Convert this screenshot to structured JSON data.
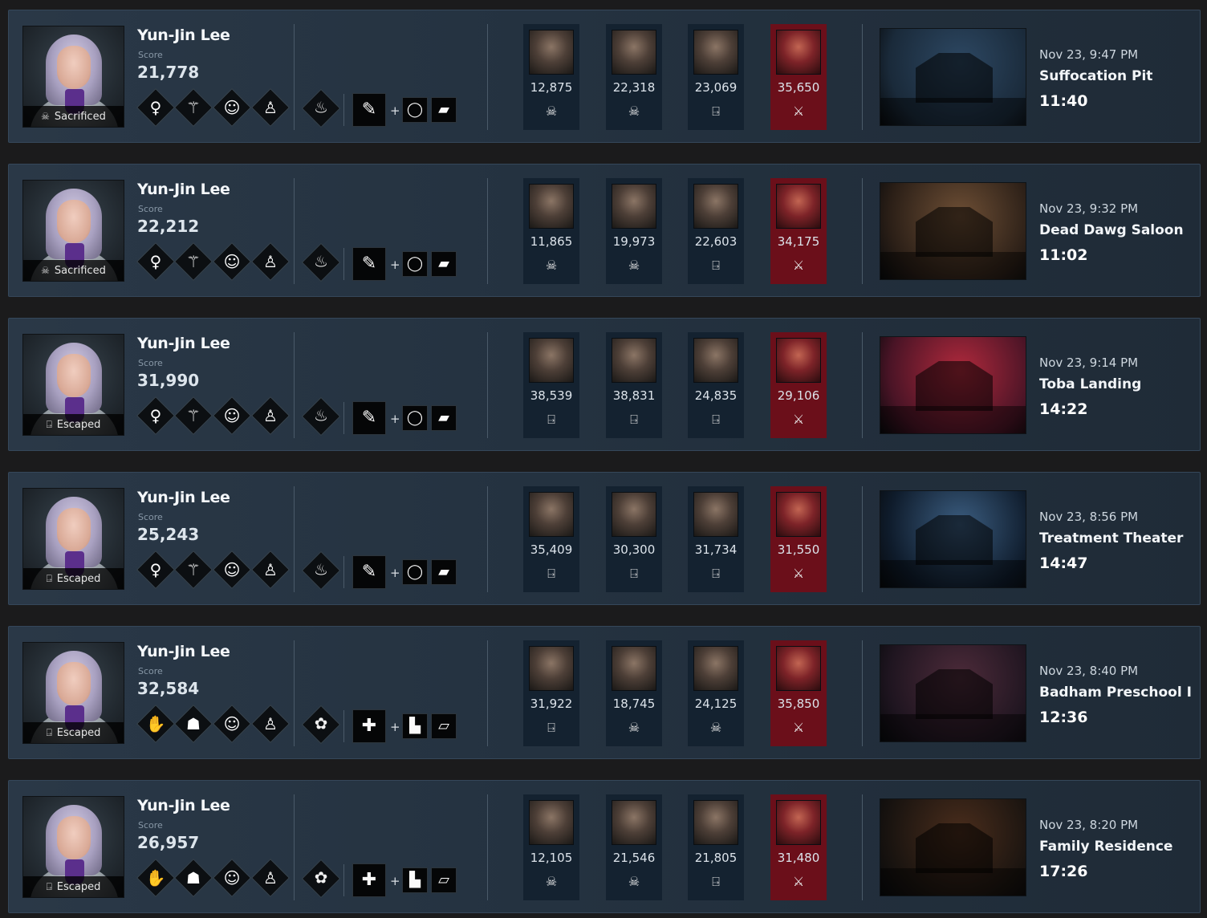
{
  "matches": [
    {
      "player": {
        "name": "Yun-Jin Lee",
        "score_label": "Score",
        "score": "21,778",
        "status": "Sacrificed",
        "status_icon": "skull"
      },
      "perks": [
        "adrenaline-icon",
        "lithe-icon",
        "fixated-icon",
        "dance-icon"
      ],
      "offering": "cake-icon",
      "item": "flashlight-icon",
      "addons": [
        "ring-icon",
        "battery-icon"
      ],
      "others": [
        {
          "score": "12,875",
          "result_icon": "skull",
          "role": "survivor"
        },
        {
          "score": "22,318",
          "result_icon": "skull",
          "role": "survivor"
        },
        {
          "score": "23,069",
          "result_icon": "escape",
          "role": "survivor"
        },
        {
          "score": "35,650",
          "result_icon": "killer",
          "role": "killer"
        }
      ],
      "map": {
        "date": "Nov 23, 9:47 PM",
        "name": "Suffocation Pit",
        "duration": "11:40",
        "tint": [
          "#1a2a3a",
          "#2d4863"
        ]
      }
    },
    {
      "player": {
        "name": "Yun-Jin Lee",
        "score_label": "Score",
        "score": "22,212",
        "status": "Sacrificed",
        "status_icon": "skull"
      },
      "perks": [
        "adrenaline-icon",
        "lithe-icon",
        "fixated-icon",
        "dance-icon"
      ],
      "offering": "cake-icon",
      "item": "flashlight-icon",
      "addons": [
        "ring-icon",
        "battery-icon"
      ],
      "others": [
        {
          "score": "11,865",
          "result_icon": "skull",
          "role": "survivor"
        },
        {
          "score": "19,973",
          "result_icon": "skull",
          "role": "survivor"
        },
        {
          "score": "22,603",
          "result_icon": "escape",
          "role": "survivor"
        },
        {
          "score": "34,175",
          "result_icon": "killer",
          "role": "killer"
        }
      ],
      "map": {
        "date": "Nov 23, 9:32 PM",
        "name": "Dead Dawg Saloon",
        "duration": "11:02",
        "tint": [
          "#2b1f17",
          "#6e4f35"
        ]
      }
    },
    {
      "player": {
        "name": "Yun-Jin Lee",
        "score_label": "Score",
        "score": "31,990",
        "status": "Escaped",
        "status_icon": "escape"
      },
      "perks": [
        "adrenaline-icon",
        "lithe-icon",
        "fixated-icon",
        "dance-icon"
      ],
      "offering": "cake-icon",
      "item": "flashlight-icon",
      "addons": [
        "ring-icon",
        "battery-icon"
      ],
      "others": [
        {
          "score": "38,539",
          "result_icon": "escape",
          "role": "survivor"
        },
        {
          "score": "38,831",
          "result_icon": "escape",
          "role": "survivor"
        },
        {
          "score": "24,835",
          "result_icon": "escape",
          "role": "survivor"
        },
        {
          "score": "29,106",
          "result_icon": "killer",
          "role": "killer"
        }
      ],
      "map": {
        "date": "Nov 23, 9:14 PM",
        "name": "Toba Landing",
        "duration": "14:22",
        "tint": [
          "#4a1426",
          "#b0293c"
        ]
      }
    },
    {
      "player": {
        "name": "Yun-Jin Lee",
        "score_label": "Score",
        "score": "25,243",
        "status": "Escaped",
        "status_icon": "escape"
      },
      "perks": [
        "adrenaline-icon",
        "lithe-icon",
        "fixated-icon",
        "dance-icon"
      ],
      "offering": "cake-icon",
      "item": "flashlight-icon",
      "addons": [
        "ring-icon",
        "battery-icon"
      ],
      "others": [
        {
          "score": "35,409",
          "result_icon": "escape",
          "role": "survivor"
        },
        {
          "score": "30,300",
          "result_icon": "escape",
          "role": "survivor"
        },
        {
          "score": "31,734",
          "result_icon": "escape",
          "role": "survivor"
        },
        {
          "score": "31,550",
          "result_icon": "killer",
          "role": "killer"
        }
      ],
      "map": {
        "date": "Nov 23, 8:56 PM",
        "name": "Treatment Theater",
        "duration": "14:47",
        "tint": [
          "#0f1c2c",
          "#3b5d80"
        ]
      }
    },
    {
      "player": {
        "name": "Yun-Jin Lee",
        "score_label": "Score",
        "score": "32,584",
        "status": "Escaped",
        "status_icon": "escape"
      },
      "perks": [
        "buckle-up-icon",
        "survivor-icon",
        "fixated-icon",
        "dance-icon"
      ],
      "offering": "flower-icon",
      "item": "medkit-icon",
      "addons": [
        "bandage-icon",
        "gauze-icon"
      ],
      "others": [
        {
          "score": "31,922",
          "result_icon": "escape",
          "role": "survivor"
        },
        {
          "score": "18,745",
          "result_icon": "skull",
          "role": "survivor"
        },
        {
          "score": "24,125",
          "result_icon": "skull",
          "role": "survivor"
        },
        {
          "score": "35,850",
          "result_icon": "killer",
          "role": "killer"
        }
      ],
      "map": {
        "date": "Nov 23, 8:40 PM",
        "name": "Badham Preschool I",
        "duration": "12:36",
        "tint": [
          "#1f1520",
          "#4d2b3a"
        ]
      }
    },
    {
      "player": {
        "name": "Yun-Jin Lee",
        "score_label": "Score",
        "score": "26,957",
        "status": "Escaped",
        "status_icon": "escape"
      },
      "perks": [
        "buckle-up-icon",
        "survivor-icon",
        "fixated-icon",
        "dance-icon"
      ],
      "offering": "flower-icon",
      "item": "medkit-icon",
      "addons": [
        "bandage-icon",
        "gauze-icon"
      ],
      "others": [
        {
          "score": "12,105",
          "result_icon": "skull",
          "role": "survivor"
        },
        {
          "score": "21,546",
          "result_icon": "skull",
          "role": "survivor"
        },
        {
          "score": "21,805",
          "result_icon": "escape",
          "role": "survivor"
        },
        {
          "score": "31,480",
          "result_icon": "killer",
          "role": "killer"
        }
      ],
      "map": {
        "date": "Nov 23, 8:20 PM",
        "name": "Family Residence",
        "duration": "17:26",
        "tint": [
          "#1a1410",
          "#4a2d1c"
        ]
      }
    }
  ],
  "icons": {
    "skull": "☠",
    "escape": "⍈",
    "killer": "⚔",
    "adrenaline-icon": "♀",
    "lithe-icon": "⚚",
    "fixated-icon": "☺",
    "dance-icon": "♙",
    "buckle-up-icon": "✋",
    "survivor-icon": "☗",
    "cake-icon": "♨",
    "flower-icon": "✿",
    "flashlight-icon": "✎",
    "medkit-icon": "✚",
    "ring-icon": "◯",
    "battery-icon": "▰",
    "bandage-icon": "▙",
    "gauze-icon": "▱"
  }
}
